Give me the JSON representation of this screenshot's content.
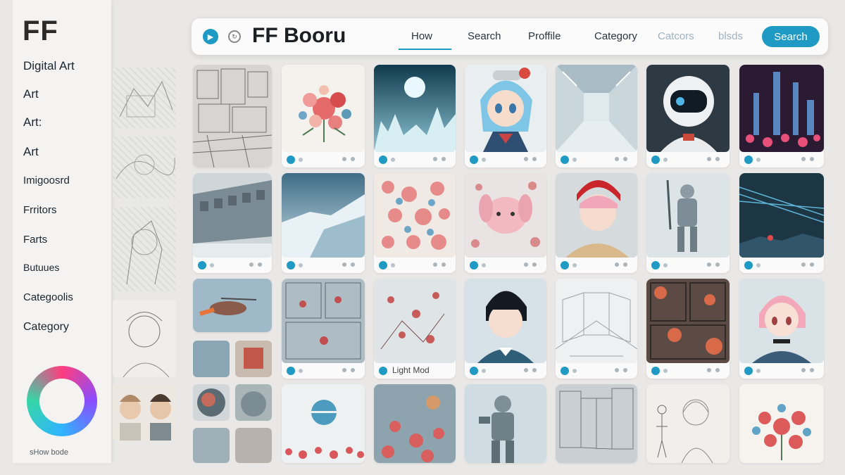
{
  "sidebar": {
    "logo": "FF",
    "items": [
      {
        "label": "Digital Art"
      },
      {
        "label": "Art"
      },
      {
        "label": "Art:"
      },
      {
        "label": "Art"
      },
      {
        "label": "Imigoosrd"
      },
      {
        "label": "Frritors"
      },
      {
        "label": "Farts"
      },
      {
        "label": "Butuues"
      },
      {
        "label": "Categoolis"
      },
      {
        "label": "Category"
      }
    ],
    "mode_label": "sHow bode"
  },
  "header": {
    "brand": "FF Booru",
    "links": [
      "How",
      "Search",
      "Proffile",
      "Category",
      "Catcors",
      "blsds"
    ],
    "search_button": "Search"
  },
  "grid": {
    "light_mode_caption": "Light Mod"
  },
  "colors": {
    "accent": "#1f9ac4",
    "background": "#e9e8e6",
    "panel": "#fbfbfb"
  }
}
